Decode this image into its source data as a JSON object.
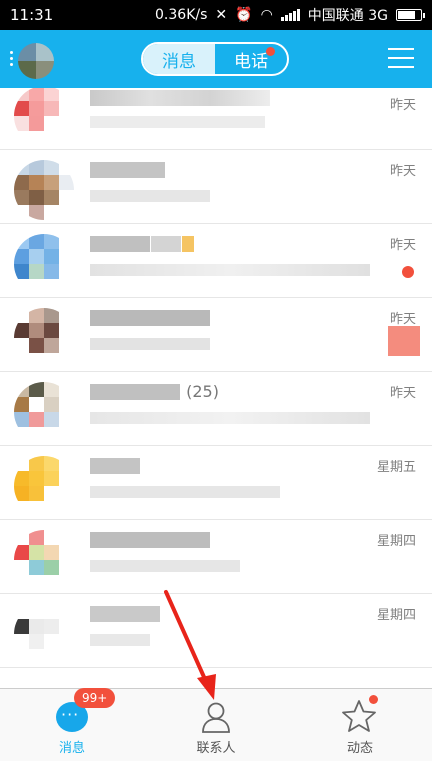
{
  "status_bar": {
    "time": "11:31",
    "speed": "0.36K/s",
    "carrier": "中国联通 3G"
  },
  "header": {
    "tabs": [
      {
        "label": "消息",
        "active": true
      },
      {
        "label": "电话",
        "active": false,
        "has_dot": true
      }
    ]
  },
  "conversations": [
    {
      "time": "昨天"
    },
    {
      "time": "昨天"
    },
    {
      "time": "昨天"
    },
    {
      "time": "昨天"
    },
    {
      "time": "昨天",
      "count": "(25)"
    },
    {
      "time": "星期五"
    },
    {
      "time": "星期四"
    },
    {
      "time": "星期四"
    }
  ],
  "tab_bar": {
    "items": [
      {
        "label": "消息",
        "badge": "99+",
        "active": true,
        "icon": "chat-icon"
      },
      {
        "label": "联系人",
        "active": false,
        "icon": "person-icon"
      },
      {
        "label": "动态",
        "active": false,
        "has_dot": true,
        "icon": "star-icon"
      }
    ]
  },
  "colors": {
    "accent": "#17b1ed",
    "badge": "#f2503c"
  }
}
